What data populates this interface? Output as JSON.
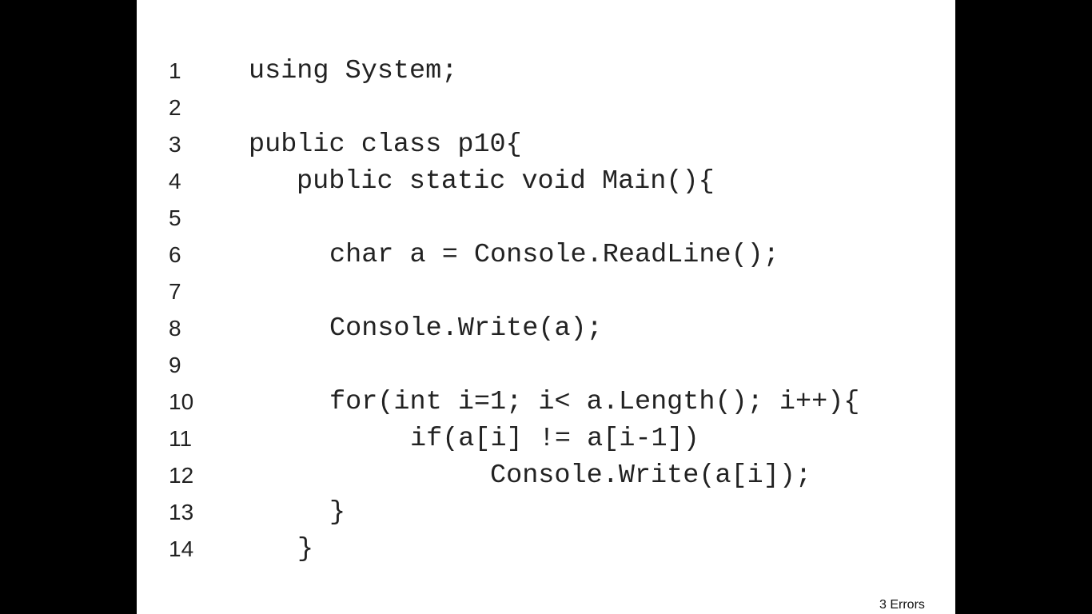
{
  "code_lines": [
    {
      "number": "1",
      "text": "using System;"
    },
    {
      "number": "2",
      "text": ""
    },
    {
      "number": "3",
      "text": "public class p10{"
    },
    {
      "number": "4",
      "text": "public static void Main(){"
    },
    {
      "number": "5",
      "text": ""
    },
    {
      "number": "6",
      "text": "char a = Console.ReadLine();"
    },
    {
      "number": "7",
      "text": ""
    },
    {
      "number": "8",
      "text": "Console.Write(a);"
    },
    {
      "number": "9",
      "text": ""
    },
    {
      "number": "10",
      "text": "for(int i=1; i< a.Length(); i++){"
    },
    {
      "number": "11",
      "text": "if(a[i] != a[i-1])"
    },
    {
      "number": "12",
      "text": "Console.Write(a[i]);"
    },
    {
      "number": "13",
      "text": "}"
    },
    {
      "number": "14",
      "text": "}"
    }
  ],
  "footer": {
    "errors_label": "3 Errors"
  }
}
